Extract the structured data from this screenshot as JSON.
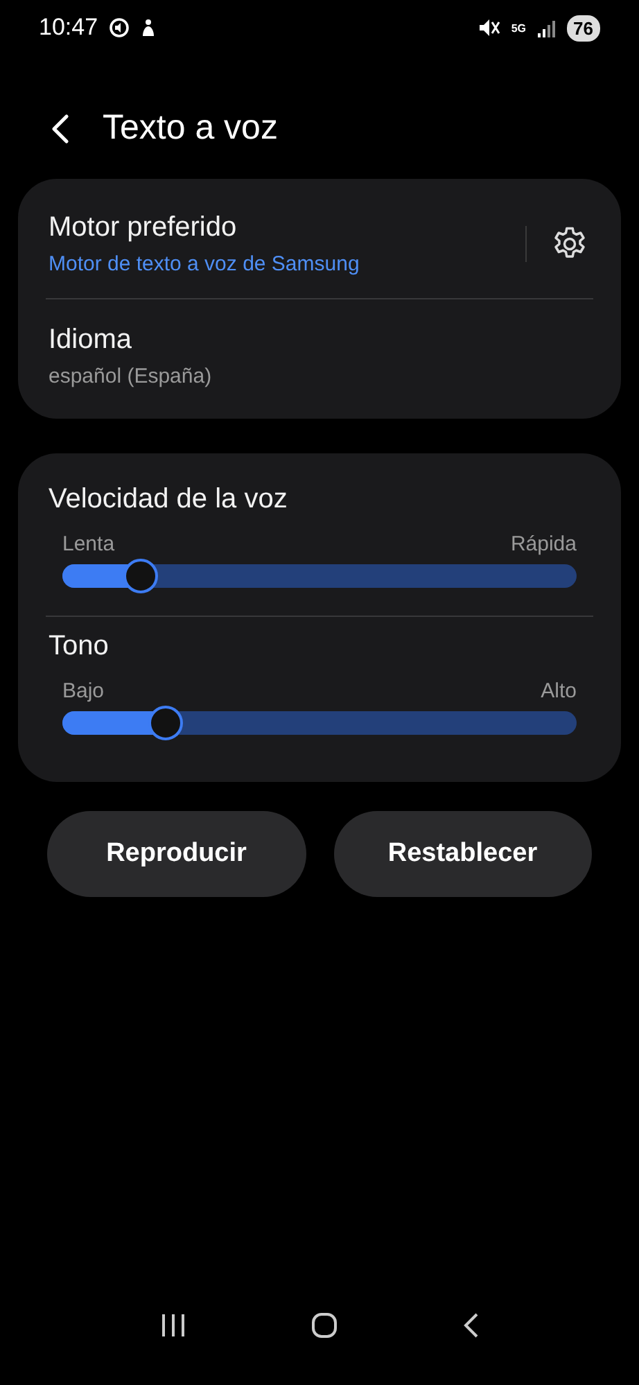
{
  "status_bar": {
    "time": "10:47",
    "network": "5G",
    "battery": "76"
  },
  "header": {
    "title": "Texto a voz"
  },
  "engine_card": {
    "rows": [
      {
        "kind": "settings",
        "title": "Motor preferido",
        "subtitle": "Motor de texto a voz de Samsung",
        "accent": true
      },
      {
        "kind": "plain",
        "title": "Idioma",
        "subtitle": "español (España)",
        "accent": false
      }
    ]
  },
  "sliders": [
    {
      "title": "Velocidad de la voz",
      "min_label": "Lenta",
      "max_label": "Rápida",
      "level": 0.15
    },
    {
      "title": "Tono",
      "min_label": "Bajo",
      "max_label": "Alto",
      "level": 0.2
    }
  ],
  "buttons": [
    "Reproducir",
    "Restablecer"
  ]
}
